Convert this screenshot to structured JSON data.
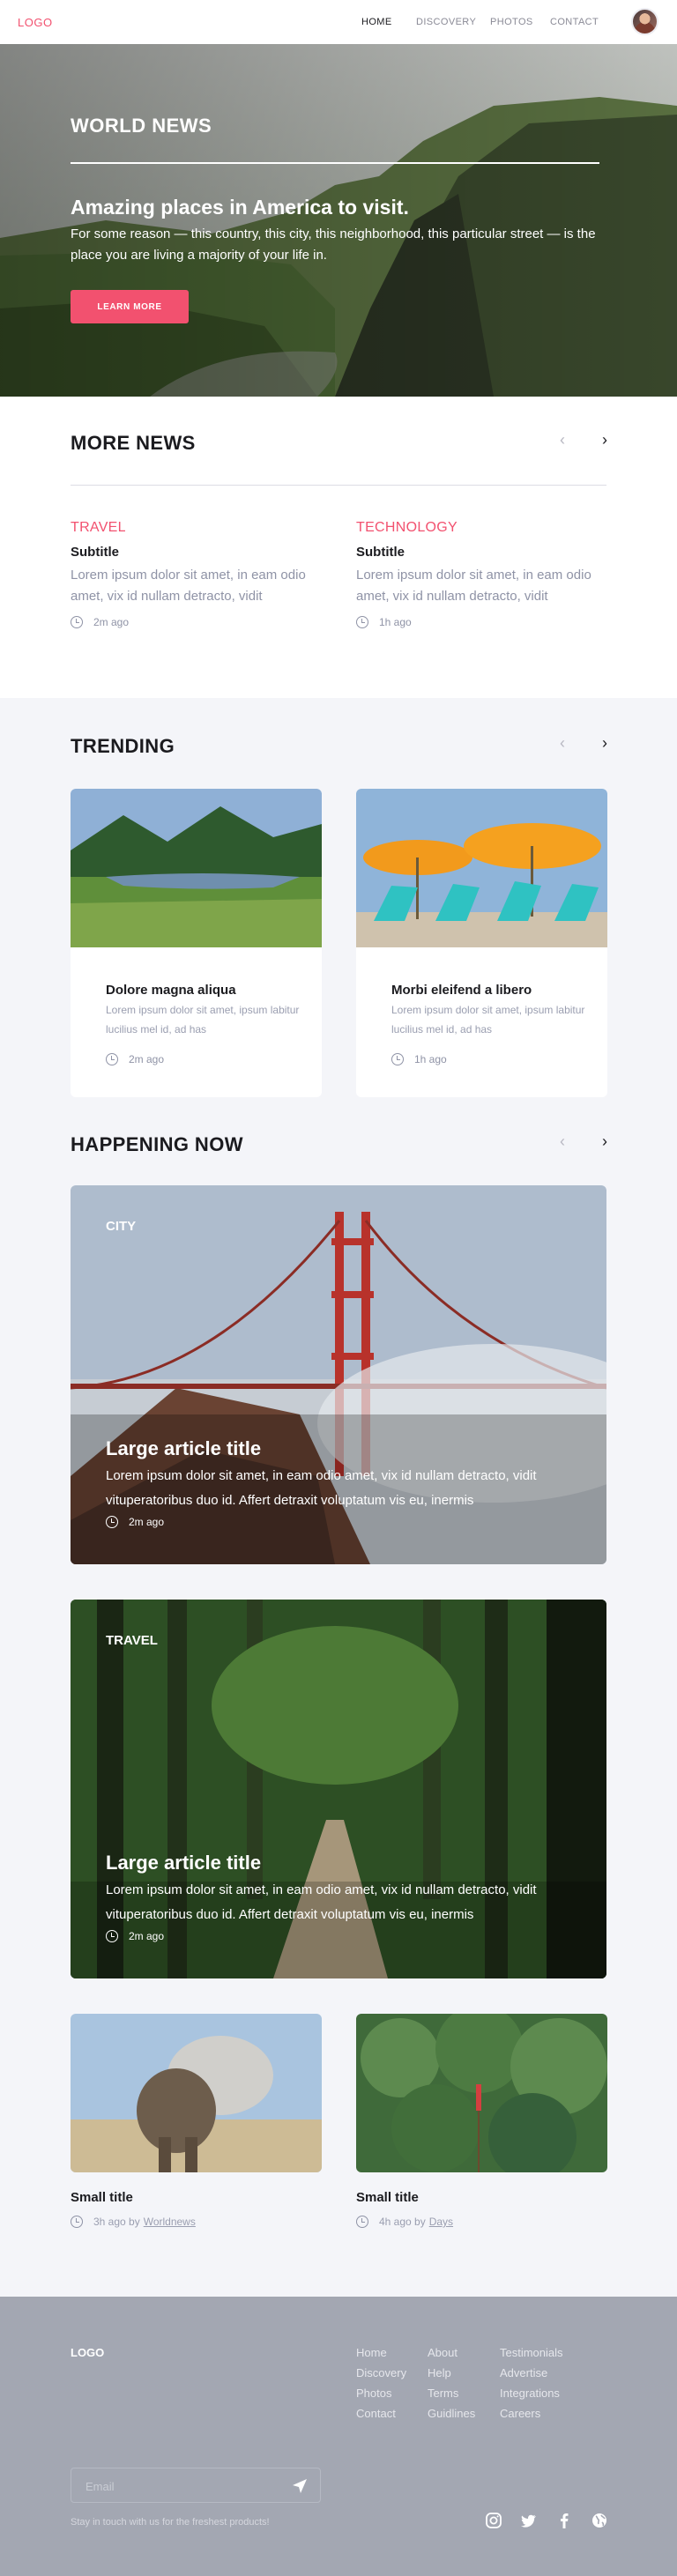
{
  "header": {
    "logo": "LOGO",
    "nav": [
      "HOME",
      "DISCOVERY",
      "PHOTOS",
      "CONTACT"
    ]
  },
  "hero": {
    "kicker": "WORLD NEWS",
    "title": "Amazing places in America to visit.",
    "text": "For some reason — this country, this city, this neighborhood, this particular street — is the place you are living a majority of your life in.",
    "button": "LEARN MORE"
  },
  "more_news": {
    "title": "MORE NEWS",
    "items": [
      {
        "category": "TRAVEL",
        "subtitle": "Subtitle",
        "text": "Lorem ipsum dolor sit amet, in eam odio amet, vix id nullam detracto, vidit",
        "time": "2m ago"
      },
      {
        "category": "TECHNOLOGY",
        "subtitle": "Subtitle",
        "text": "Lorem ipsum dolor sit amet, in eam odio amet, vix id nullam detracto, vidit",
        "time": "1h ago"
      }
    ]
  },
  "trending": {
    "title": "TRENDING",
    "items": [
      {
        "title": "Dolore magna aliqua",
        "text": "Lorem ipsum dolor sit amet, ipsum labitur lucilius mel id, ad has",
        "time": "2m ago"
      },
      {
        "title": "Morbi eleifend a libero",
        "text": "Lorem ipsum dolor sit amet, ipsum labitur lucilius mel id, ad has",
        "time": "1h ago"
      }
    ]
  },
  "happening": {
    "title": "HAPPENING NOW",
    "big": [
      {
        "category": "CITY",
        "title": "Large article title",
        "text": "Lorem ipsum dolor sit amet, in eam odio amet, vix id nullam detracto, vidit vituperatoribus duo id. Affert detraxit voluptatum vis eu, inermis",
        "time": "2m ago"
      },
      {
        "category": "TRAVEL",
        "title": "Large article title",
        "text": "Lorem ipsum dolor sit amet, in eam odio amet, vix id nullam detracto, vidit vituperatoribus duo id. Affert detraxit voluptatum vis eu, inermis",
        "time": "2m ago"
      }
    ],
    "small": [
      {
        "title": "Small title",
        "time": "3h ago by",
        "author": "Worldnews"
      },
      {
        "title": "Small title",
        "time": "4h ago by",
        "author": "Days"
      }
    ]
  },
  "footer": {
    "logo": "LOGO",
    "links": [
      [
        "Home",
        "Discovery",
        "Photos",
        "Contact"
      ],
      [
        "About",
        "Help",
        "Terms",
        "Guidlines"
      ],
      [
        "Testimonials",
        "Advertise",
        "Integrations",
        "Careers"
      ]
    ],
    "email_placeholder": "Email",
    "note": "Stay in touch with us for the freshest products!",
    "social_icons": [
      "instagram-icon",
      "twitter-icon",
      "facebook-icon",
      "globe-icon"
    ]
  },
  "colors": {
    "accent": "#f2516f",
    "muted": "#8f93a6",
    "footer_bg": "#a3a7b2",
    "band_bg": "#f4f5f9"
  }
}
